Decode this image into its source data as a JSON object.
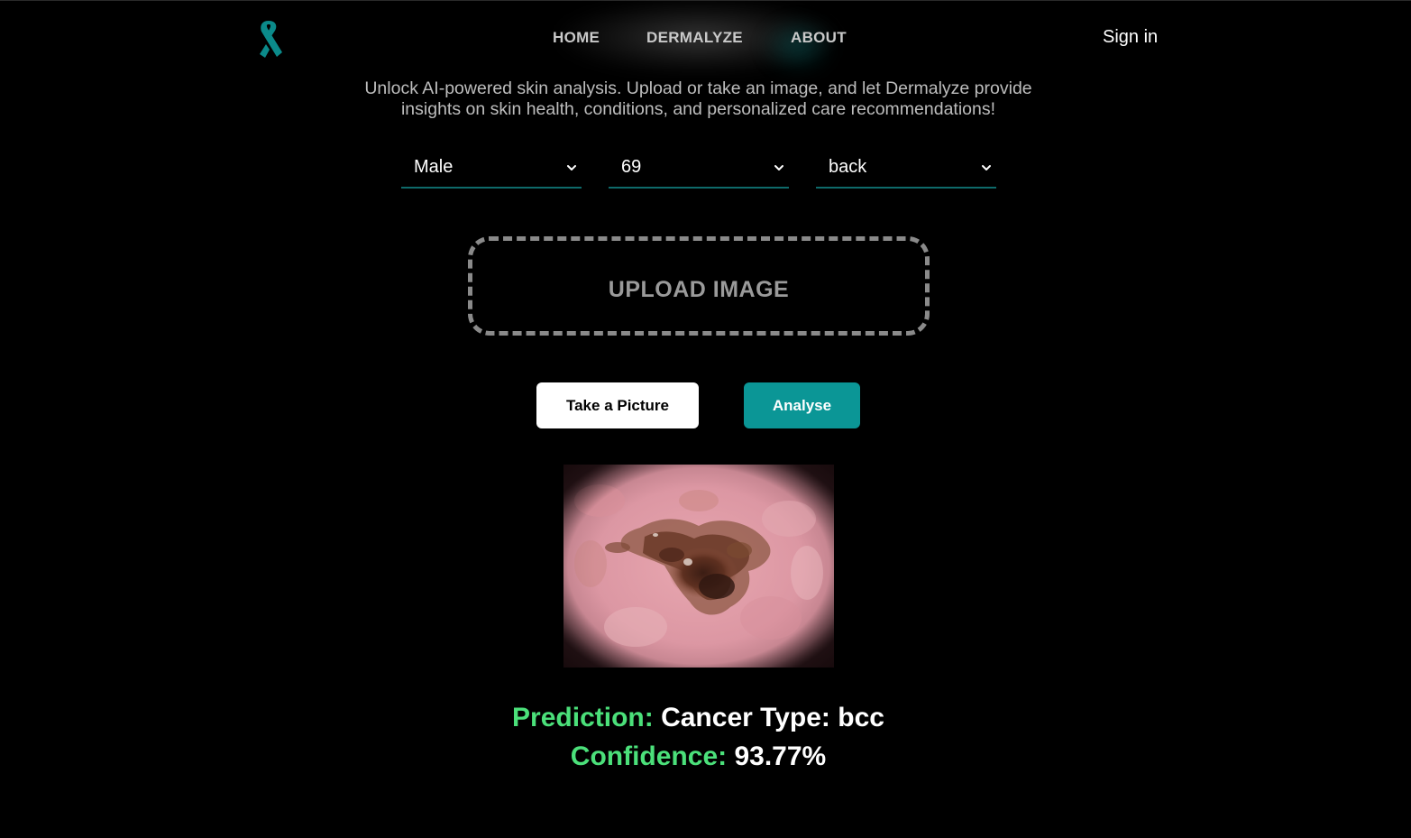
{
  "header": {
    "logo_icon": "awareness-ribbon-icon",
    "accent_color": "#0b8a8a",
    "nav": [
      {
        "label": "HOME"
      },
      {
        "label": "DERMALYZE"
      },
      {
        "label": "ABOUT"
      }
    ],
    "signin_label": "Sign in"
  },
  "intro": {
    "line1": "Unlock AI-powered skin analysis. Upload or take an image, and let Dermalyze provide",
    "line2": "insights on skin health, conditions, and personalized care recommendations!"
  },
  "form": {
    "gender": "Male",
    "age": "69",
    "location": "back",
    "chevron_icon": "chevron-down-icon"
  },
  "upload": {
    "label": "UPLOAD IMAGE"
  },
  "buttons": {
    "take_picture": "Take a Picture",
    "analyse": "Analyse",
    "analyse_color": "#0b9696"
  },
  "result": {
    "prediction_key": "Prediction:",
    "prediction_value": "Cancer Type: bcc",
    "confidence_key": "Confidence:",
    "confidence_value": "93.77%",
    "key_color": "#4be07a"
  }
}
